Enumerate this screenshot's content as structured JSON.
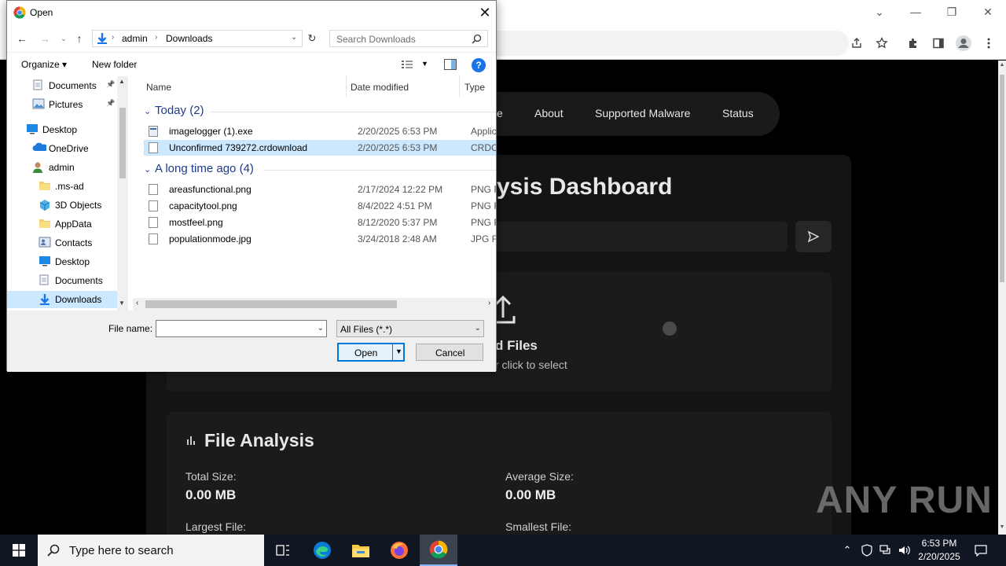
{
  "browser": {
    "window_controls": {
      "chevron": "⌄",
      "minimize": "—",
      "restore": "❐",
      "close": "✕"
    },
    "toolbar_icons": [
      "share-icon",
      "star-icon",
      "extension-icon",
      "sidepanel-icon",
      "profile-icon",
      "menu-icon"
    ]
  },
  "website": {
    "nav": {
      "item_partial": "e",
      "about": "About",
      "supported": "Supported Malware",
      "status": "Status"
    },
    "title_partial": "ysis Dashboard",
    "upload_title_partial": "d Files",
    "upload_sub_partial": "r click to select",
    "analysis_title": "File Analysis",
    "stats": {
      "total_label": "Total Size:",
      "total_value": "0.00 MB",
      "avg_label": "Average Size:",
      "avg_value": "0.00 MB",
      "largest_label": "Largest File:",
      "smallest_label": "Smallest File:"
    },
    "watermark": "ANY RUN"
  },
  "dialog": {
    "title": "Open",
    "address": {
      "seg1": "admin",
      "seg2": "Downloads"
    },
    "search_placeholder": "Search Downloads",
    "organize": "Organize ▾",
    "new_folder": "New folder",
    "help": "?",
    "nav_items": [
      {
        "label": "Documents",
        "icon": "documents-icon",
        "pinned": true
      },
      {
        "label": "Pictures",
        "icon": "pictures-icon",
        "pinned": true
      },
      {
        "label": "Desktop",
        "icon": "desktop-icon",
        "pinned": false
      },
      {
        "label": "OneDrive",
        "icon": "onedrive-icon",
        "pinned": false
      },
      {
        "label": "admin",
        "icon": "user-icon",
        "pinned": false
      },
      {
        "label": ".ms-ad",
        "icon": "folder-icon",
        "pinned": false
      },
      {
        "label": "3D Objects",
        "icon": "3d-objects-icon",
        "pinned": false
      },
      {
        "label": "AppData",
        "icon": "folder-icon",
        "pinned": false
      },
      {
        "label": "Contacts",
        "icon": "contacts-icon",
        "pinned": false
      },
      {
        "label": "Desktop",
        "icon": "desktop-icon",
        "pinned": false
      },
      {
        "label": "Documents",
        "icon": "documents-icon",
        "pinned": false
      },
      {
        "label": "Downloads",
        "icon": "downloads-icon",
        "pinned": false
      }
    ],
    "columns": {
      "name": "Name",
      "date": "Date modified",
      "type": "Type"
    },
    "groups": [
      {
        "label": "Today (2)",
        "files": [
          {
            "name": "imagelogger (1).exe",
            "date": "2/20/2025 6:53 PM",
            "type": "Applicat"
          },
          {
            "name": "Unconfirmed 739272.crdownload",
            "date": "2/20/2025 6:53 PM",
            "type": "CRDOW"
          }
        ]
      },
      {
        "label": "A long time ago (4)",
        "files": [
          {
            "name": "areasfunctional.png",
            "date": "2/17/2024 12:22 PM",
            "type": "PNG File"
          },
          {
            "name": "capacitytool.png",
            "date": "8/4/2022 4:51 PM",
            "type": "PNG File"
          },
          {
            "name": "mostfeel.png",
            "date": "8/12/2020 5:37 PM",
            "type": "PNG File"
          },
          {
            "name": "populationmode.jpg",
            "date": "3/24/2018 2:48 AM",
            "type": "JPG File"
          }
        ]
      }
    ],
    "file_name_label": "File name:",
    "file_name_value": "",
    "filter": "All Files (*.*)",
    "open": "Open",
    "cancel": "Cancel"
  },
  "taskbar": {
    "search_placeholder": "Type here to search",
    "time": "6:53 PM",
    "date": "2/20/2025"
  },
  "colors": {
    "accent": "#0078d7",
    "selection": "#cce8ff",
    "group_header": "#1e3a8a",
    "taskbar": "#101622"
  }
}
